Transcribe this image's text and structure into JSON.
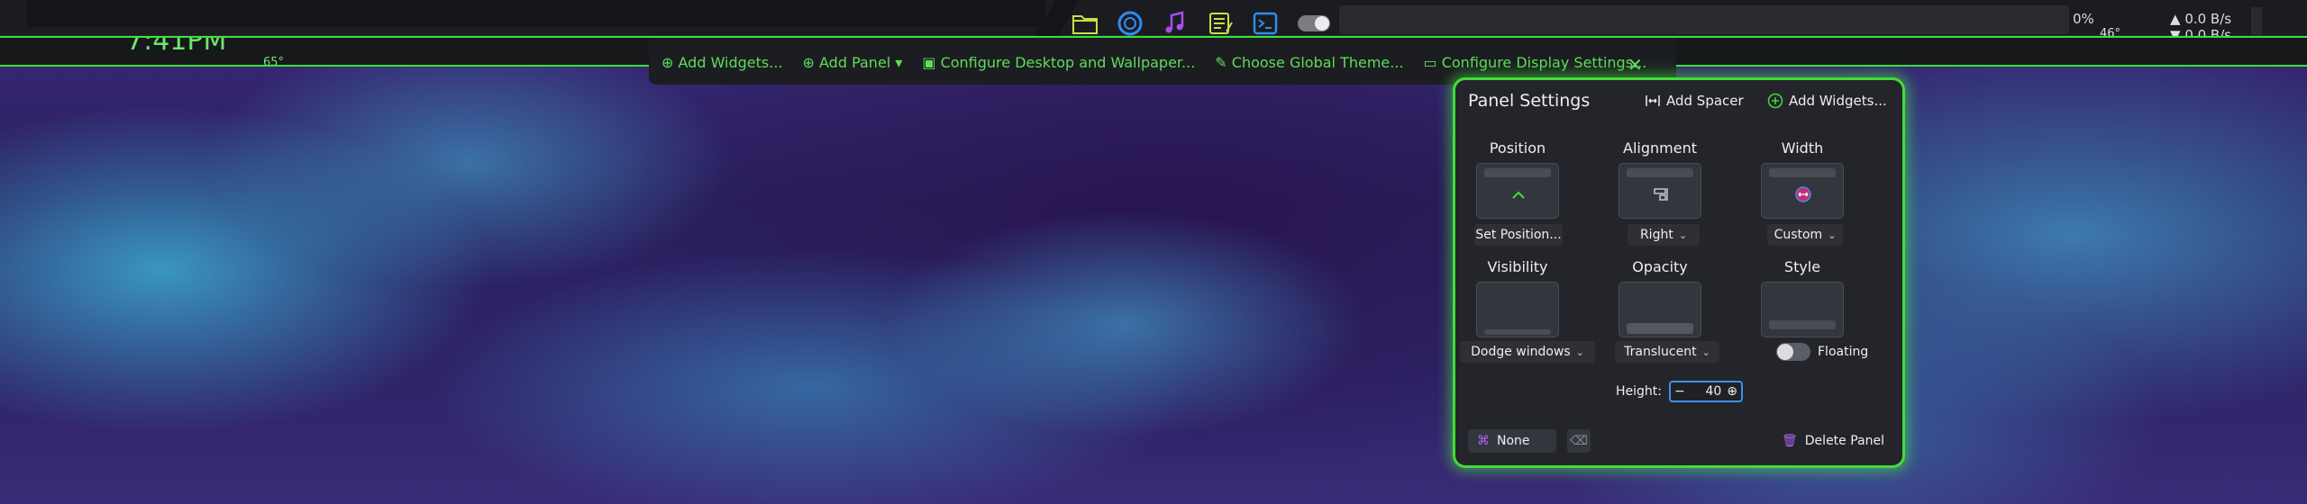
{
  "topbar": {
    "tasks": [
      {
        "icon": "folder-icon",
        "color": "#c6e04a"
      },
      {
        "icon": "browser-icon",
        "color": "#2e8cf5"
      },
      {
        "icon": "music-icon",
        "color": "#a64ef0"
      },
      {
        "icon": "notes-icon",
        "color": "#c6e04a"
      },
      {
        "icon": "terminal-icon",
        "color": "#2e8cf5"
      }
    ],
    "tray": {
      "cpu": "0%",
      "temp": "46°",
      "net_up": "0.0 B/s",
      "net_down": "0.0 B/s"
    }
  },
  "hidden_panel": {
    "clock": "7:41PM",
    "weather": "65°"
  },
  "edit_toolbar": {
    "items": [
      {
        "label": "Add Widgets..."
      },
      {
        "label": "Add Panel"
      },
      {
        "label": "Configure Desktop and Wallpaper..."
      },
      {
        "label": "Choose Global Theme..."
      },
      {
        "label": "Configure Display Settings..."
      }
    ],
    "close": "✕"
  },
  "dialog": {
    "title": "Panel Settings",
    "add_spacer": "Add Spacer",
    "add_widgets": "Add Widgets...",
    "sections": {
      "position": {
        "label": "Position",
        "control": "Set Position..."
      },
      "alignment": {
        "label": "Alignment",
        "control": "Right"
      },
      "width": {
        "label": "Width",
        "control": "Custom"
      },
      "visibility": {
        "label": "Visibility",
        "control": "Dodge windows"
      },
      "opacity": {
        "label": "Opacity",
        "control": "Translucent"
      },
      "style": {
        "label": "Style",
        "control": "Floating"
      }
    },
    "height_label": "Height:",
    "height_value": "40",
    "shortcut_button": "None",
    "delete_panel": "Delete Panel",
    "accent": "#42dc3a",
    "focus": "#3f8ef0"
  }
}
